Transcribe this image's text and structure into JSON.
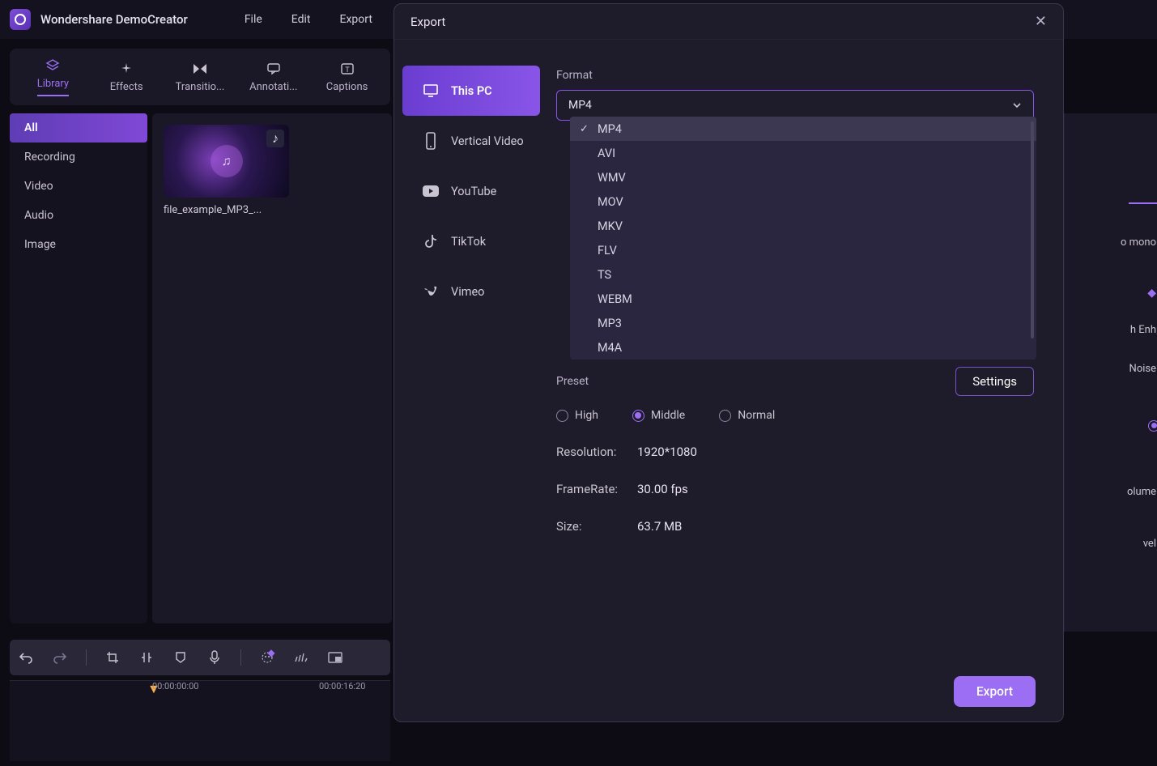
{
  "app": {
    "title": "Wondershare DemoCreator"
  },
  "menubar": {
    "file": "File",
    "edit": "Edit",
    "export": "Export"
  },
  "tooltabs": {
    "library": "Library",
    "effects": "Effects",
    "transitions": "Transitio...",
    "annotations": "Annotati...",
    "captions": "Captions"
  },
  "sidebar": {
    "all": "All",
    "recording": "Recording",
    "video": "Video",
    "audio": "Audio",
    "image": "Image"
  },
  "media": {
    "file1": "file_example_MP3_..."
  },
  "timeline": {
    "t0": "00:00:00:00",
    "t1": "00:00:16:20"
  },
  "export_modal": {
    "title": "Export",
    "destinations": {
      "this_pc": "This PC",
      "vertical": "Vertical Video",
      "youtube": "YouTube",
      "tiktok": "TikTok",
      "vimeo": "Vimeo"
    },
    "format_label": "Format",
    "format_value": "MP4",
    "format_options": [
      "MP4",
      "AVI",
      "WMV",
      "MOV",
      "MKV",
      "FLV",
      "TS",
      "WEBM",
      "MP3",
      "M4A"
    ],
    "preset_label": "Preset",
    "settings_btn": "Settings",
    "preset_options": {
      "high": "High",
      "middle": "Middle",
      "normal": "Normal"
    },
    "preset_selected": "middle",
    "resolution_label": "Resolution:",
    "resolution_value": "1920*1080",
    "framerate_label": "FrameRate:",
    "framerate_value": "30.00 fps",
    "size_label": "Size:",
    "size_value": "63.7 MB",
    "export_btn": "Export"
  },
  "rightpanel": {
    "mono": "o mono",
    "enhance": "h Enh",
    "noise": "Noise",
    "volume": "olume",
    "level": "vel"
  }
}
